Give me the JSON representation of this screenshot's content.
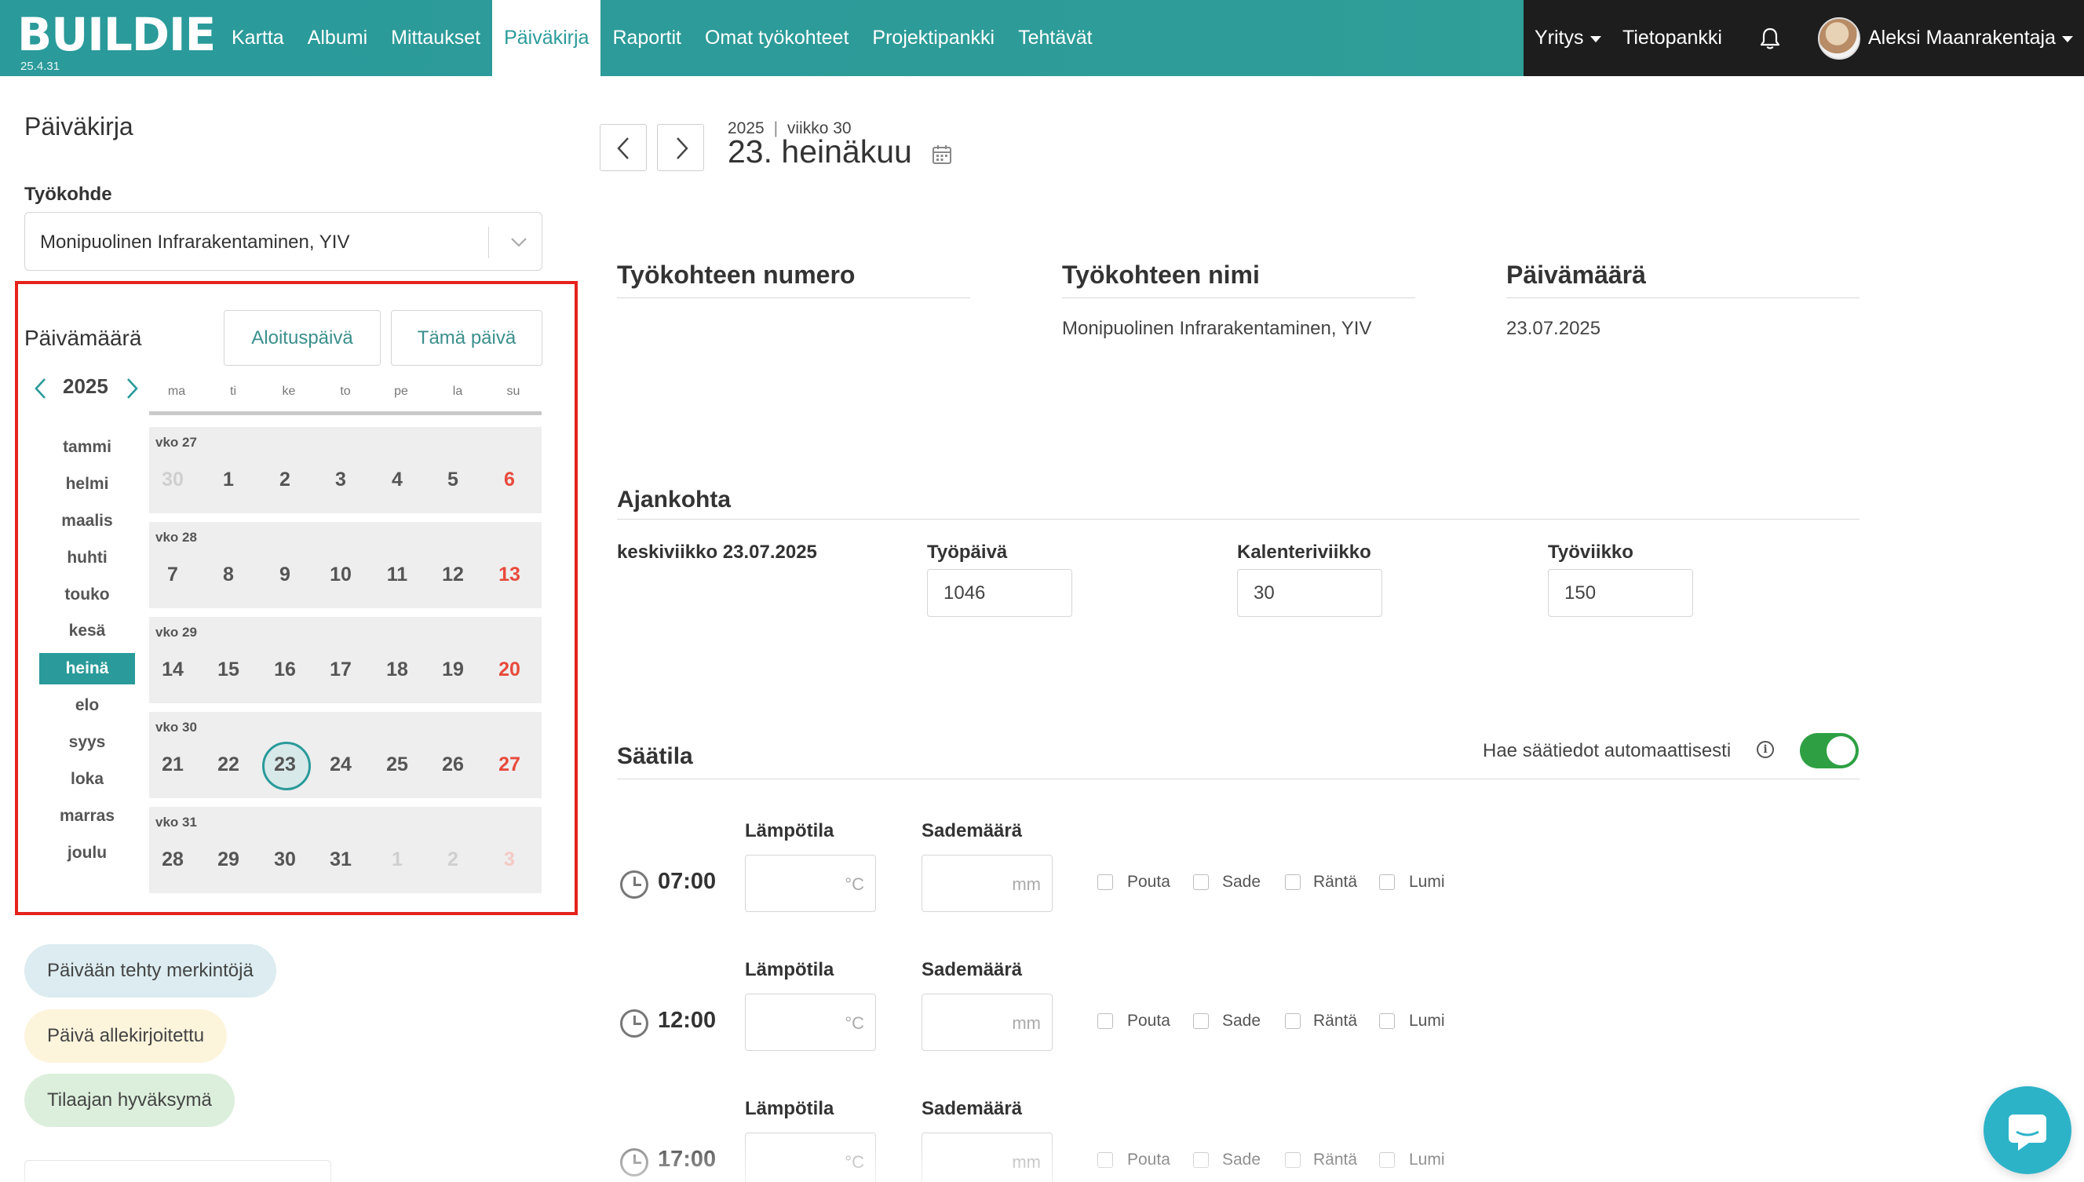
{
  "app": {
    "logo": "BUILDIE",
    "version": "25.4.31"
  },
  "nav": [
    {
      "label": "Kartta",
      "active": false
    },
    {
      "label": "Albumi",
      "active": false
    },
    {
      "label": "Mittaukset",
      "active": false
    },
    {
      "label": "Päiväkirja",
      "active": true
    },
    {
      "label": "Raportit",
      "active": false
    },
    {
      "label": "Omat työkohteet",
      "active": false
    },
    {
      "label": "Projektipankki",
      "active": false
    },
    {
      "label": "Tehtävät",
      "active": false
    }
  ],
  "topbar_right": {
    "company": "Yritys",
    "knowledge_base": "Tietopankki",
    "notifications_icon": "bell-icon",
    "user_name": "Aleksi Maanrakentaja"
  },
  "sidebar": {
    "title": "Päiväkirja",
    "site_label": "Työkohde",
    "site_value": "Monipuolinen Infrarakentaminen, YIV",
    "date_label": "Päivämäärä",
    "start_day_button": "Aloituspäivä",
    "today_button": "Tämä päivä",
    "year": "2025",
    "weekdays": [
      "ma",
      "ti",
      "ke",
      "to",
      "pe",
      "la",
      "su"
    ],
    "months": [
      "tammi",
      "helmi",
      "maalis",
      "huhti",
      "touko",
      "kesä",
      "heinä",
      "elo",
      "syys",
      "loka",
      "marras",
      "joulu"
    ],
    "active_month": "heinä",
    "weeks": [
      {
        "label": "vko 27",
        "days": [
          [
            "30",
            true
          ],
          [
            "1",
            false
          ],
          [
            "2",
            false
          ],
          [
            "3",
            false
          ],
          [
            "4",
            false
          ],
          [
            "5",
            false
          ],
          [
            "6",
            false
          ]
        ]
      },
      {
        "label": "vko 28",
        "days": [
          [
            "7",
            false
          ],
          [
            "8",
            false
          ],
          [
            "9",
            false
          ],
          [
            "10",
            false
          ],
          [
            "11",
            false
          ],
          [
            "12",
            false
          ],
          [
            "13",
            false
          ]
        ]
      },
      {
        "label": "vko 29",
        "days": [
          [
            "14",
            false
          ],
          [
            "15",
            false
          ],
          [
            "16",
            false
          ],
          [
            "17",
            false
          ],
          [
            "18",
            false
          ],
          [
            "19",
            false
          ],
          [
            "20",
            false
          ]
        ]
      },
      {
        "label": "vko 30",
        "days": [
          [
            "21",
            false
          ],
          [
            "22",
            false
          ],
          [
            "23",
            false
          ],
          [
            "24",
            false
          ],
          [
            "25",
            false
          ],
          [
            "26",
            false
          ],
          [
            "27",
            false
          ]
        ]
      },
      {
        "label": "vko 31",
        "days": [
          [
            "28",
            false
          ],
          [
            "29",
            false
          ],
          [
            "30",
            false
          ],
          [
            "31",
            false
          ],
          [
            "1",
            true
          ],
          [
            "2",
            true
          ],
          [
            "3",
            true
          ]
        ]
      }
    ],
    "selected_day": "23",
    "legend": [
      {
        "label": "Päivään tehty merkintöjä",
        "color": "#dcecf0"
      },
      {
        "label": "Päivä allekirjoitettu",
        "color": "#fdf4dc"
      },
      {
        "label": "Tilaajan hyväksymä",
        "color": "#dcefdc"
      }
    ]
  },
  "main": {
    "date_meta_year": "2025",
    "date_meta_week": "viikko 30",
    "date_title": "23. heinäkuu",
    "info": {
      "site_number_label": "Työkohteen numero",
      "site_number_value": "",
      "site_name_label": "Työkohteen nimi",
      "site_name_value": "Monipuolinen Infrarakentaminen, YIV",
      "date_label": "Päivämäärä",
      "date_value": "23.07.2025"
    },
    "timing": {
      "title": "Ajankohta",
      "weekday_date": "keskiviikko 23.07.2025",
      "workday_label": "Työpäivä",
      "workday_value": "1046",
      "calendar_week_label": "Kalenteriviikko",
      "calendar_week_value": "30",
      "work_week_label": "Työviikko",
      "work_week_value": "150"
    },
    "weather": {
      "title": "Säätila",
      "auto_fetch_label": "Hae säätiedot automaattisesti",
      "auto_fetch_enabled": true,
      "temp_label": "Lämpötila",
      "temp_unit": "°C",
      "rain_label": "Sademäärä",
      "rain_unit": "mm",
      "conditions": [
        "Pouta",
        "Sade",
        "Räntä",
        "Lumi"
      ],
      "times": [
        "07:00",
        "12:00",
        "17:00"
      ]
    }
  },
  "colors": {
    "brand_teal": "#2a9a9a",
    "topbar_dark": "#1d1d1d",
    "sunday_red": "#e84a3c",
    "toggle_green": "#2ea043",
    "highlight_red": "#e5231c",
    "chat_blue": "#2db3c8"
  }
}
